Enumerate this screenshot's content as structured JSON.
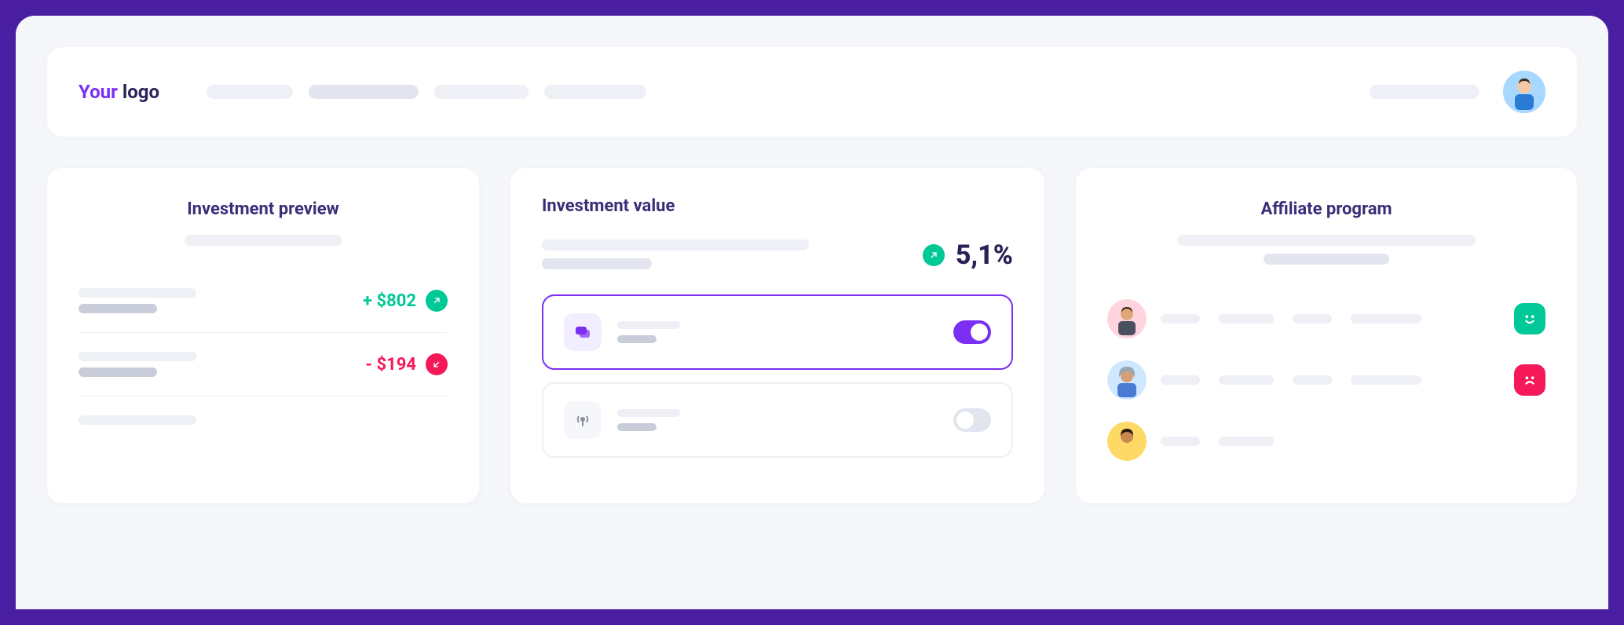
{
  "header": {
    "logo_prefix": "Your",
    "logo_suffix": " logo"
  },
  "preview": {
    "title": "Investment preview",
    "rows": [
      {
        "amount": "+ $802",
        "direction": "up"
      },
      {
        "amount": "- $194",
        "direction": "down"
      }
    ]
  },
  "value": {
    "title": "Investment value",
    "percent": "5,1%",
    "options": [
      {
        "icon": "chat-icon",
        "active": true,
        "toggle": true
      },
      {
        "icon": "broadcast-icon",
        "active": false,
        "toggle": false
      }
    ]
  },
  "affiliate": {
    "title": "Affiliate program",
    "rows": [
      {
        "avatar_bg": "#ffd4de",
        "status": "happy"
      },
      {
        "avatar_bg": "#cfe7ff",
        "status": "sad"
      },
      {
        "avatar_bg": "#ffd966",
        "status": "happy"
      }
    ]
  },
  "colors": {
    "accent": "#7b2ff2",
    "positive": "#00c896",
    "negative": "#f5195a",
    "text_dark": "#2c2156"
  }
}
